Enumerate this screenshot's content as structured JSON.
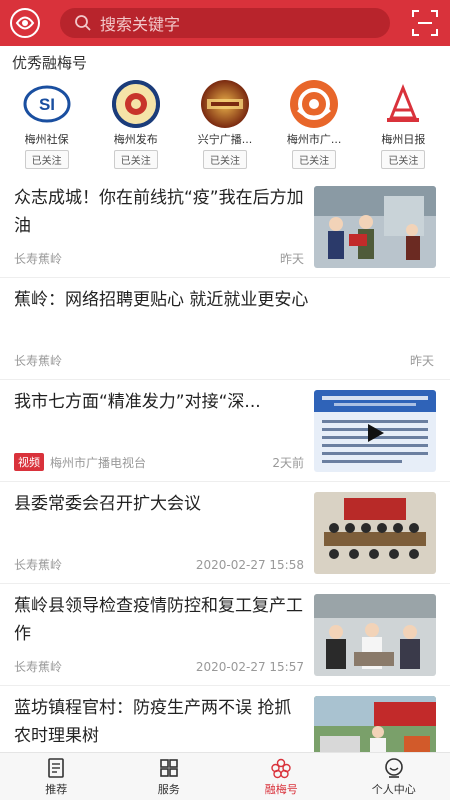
{
  "header": {
    "search_placeholder": "搜索关键字"
  },
  "section": {
    "title": "优秀融梅号"
  },
  "accounts": [
    {
      "name": "梅州社保",
      "follow": "已关注"
    },
    {
      "name": "梅州发布",
      "follow": "已关注"
    },
    {
      "name": "兴宁广播...",
      "follow": "已关注"
    },
    {
      "name": "梅州市广...",
      "follow": "已关注"
    },
    {
      "name": "梅州日报",
      "follow": "已关注"
    }
  ],
  "news": [
    {
      "title": "众志成城！你在前线抗“疫”我在后方加油",
      "source": "长寿蕉岭",
      "time": "昨天"
    },
    {
      "title": "蕉岭：网络招聘更贴心 就近就业更安心",
      "source": "长寿蕉岭",
      "time": "昨天"
    },
    {
      "title": "我市七方面“精准发力”对接“深...",
      "badge": "视频",
      "source": "梅州市广播电视台",
      "time": "2天前"
    },
    {
      "title": "县委常委会召开扩大会议",
      "source": "长寿蕉岭",
      "time": "2020-02-27 15:58"
    },
    {
      "title": "蕉岭县领导检查疫情防控和复工复产工作",
      "source": "长寿蕉岭",
      "time": "2020-02-27 15:57"
    },
    {
      "title": "蓝坊镇程官村：防疫生产两不误 抢抓农时理果树",
      "source": "",
      "time": ""
    }
  ],
  "tabbar": {
    "items": [
      {
        "label": "推荐",
        "icon": "news-icon"
      },
      {
        "label": "服务",
        "icon": "grid-icon"
      },
      {
        "label": "融梅号",
        "icon": "plum-icon"
      },
      {
        "label": "个人中心",
        "icon": "user-icon"
      }
    ]
  },
  "colors": {
    "brand": "#d9323b"
  }
}
